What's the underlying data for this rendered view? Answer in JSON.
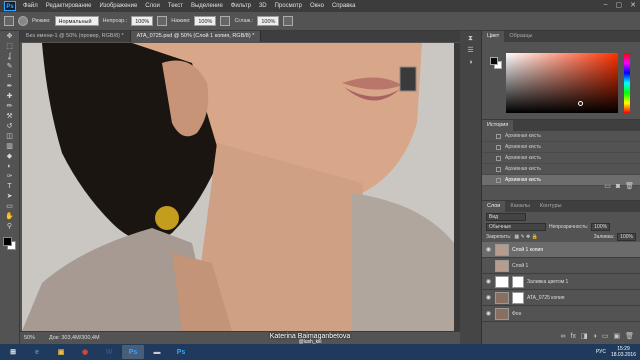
{
  "app": {
    "logo": "Ps"
  },
  "menu": [
    "Файл",
    "Редактирование",
    "Изображение",
    "Слои",
    "Текст",
    "Выделение",
    "Фильтр",
    "3D",
    "Просмотр",
    "Окно",
    "Справка"
  ],
  "window_controls": [
    "–",
    "▢",
    "✕"
  ],
  "options": {
    "mode_label": "Режим:",
    "mode_value": "Нормальный",
    "opacity_label": "Непрозр.:",
    "opacity_value": "100%",
    "flow_label": "Нажим:",
    "flow_value": "100%",
    "smooth_label": "Сглаж.:",
    "smooth_value": "100%"
  },
  "tools": [
    "move-icon",
    "marquee-icon",
    "lasso-icon",
    "quick-select-icon",
    "crop-icon",
    "eyedropper-icon",
    "healing-icon",
    "brush-icon",
    "stamp-icon",
    "history-brush-icon",
    "eraser-icon",
    "gradient-icon",
    "blur-icon",
    "dodge-icon",
    "pen-icon",
    "type-icon",
    "path-select-icon",
    "shape-icon",
    "hand-icon",
    "zoom-icon"
  ],
  "tool_glyphs": [
    "✥",
    "⬚",
    "ʆ",
    "✎",
    "⌗",
    "✒",
    "✚",
    "✏",
    "⚒",
    "↺",
    "◫",
    "▥",
    "◆",
    "◐",
    "✑",
    "T",
    "➤",
    "▭",
    "✋",
    "⚲"
  ],
  "doc_tabs": [
    {
      "label": "Без имени-1 @ 50% (провер, RGB/8) *",
      "active": false
    },
    {
      "label": "ATA_0725.psd @ 50% (Слой 1 копия, RGB/8) *",
      "active": true
    }
  ],
  "status": {
    "zoom": "50%",
    "doc": "Док: 303,4M/300,4M"
  },
  "watermark": {
    "name": "Katerina Baimaganbetova",
    "handle": "@lush_kiii"
  },
  "color_panel": {
    "tabs": [
      "Цвет",
      "Образцы"
    ],
    "colors": {
      "foreground": "#0a0a0a",
      "background": "#ffffff",
      "hue": "#ff3000"
    }
  },
  "history": {
    "tab": "История",
    "items": [
      {
        "label": "Архивная кисть",
        "selected": false
      },
      {
        "label": "Архивная кисть",
        "selected": false
      },
      {
        "label": "Архивная кисть",
        "selected": false
      },
      {
        "label": "Архивная кисть",
        "selected": false
      },
      {
        "label": "Архивная кисть",
        "selected": true
      }
    ]
  },
  "layers_panel": {
    "tabs": [
      "Слои",
      "Каналы",
      "Контуры"
    ],
    "filter": "Вид",
    "blend": "Обычные",
    "opacity_label": "Непрозрачность:",
    "opacity_value": "100%",
    "lock_label": "Закрепить:",
    "fill_label": "Заливка:",
    "fill_value": "100%",
    "layers": [
      {
        "name": "Слой 1 копия",
        "selected": true,
        "visible": true,
        "mask": false
      },
      {
        "name": "Слой 1",
        "selected": false,
        "visible": false,
        "mask": false
      },
      {
        "name": "Заливка цветом 1",
        "selected": false,
        "visible": true,
        "mask": true
      },
      {
        "name": "ATA_0725 копия",
        "selected": false,
        "visible": true,
        "mask": true
      },
      {
        "name": "Фон",
        "selected": false,
        "visible": true,
        "mask": false
      }
    ]
  },
  "taskbar": {
    "apps": [
      "⊞",
      "e",
      "▣",
      "◉",
      "W",
      "Ps",
      "▬",
      "Ps"
    ],
    "lang": "РУС",
    "time": "15:29",
    "date": "18.03.2016"
  }
}
